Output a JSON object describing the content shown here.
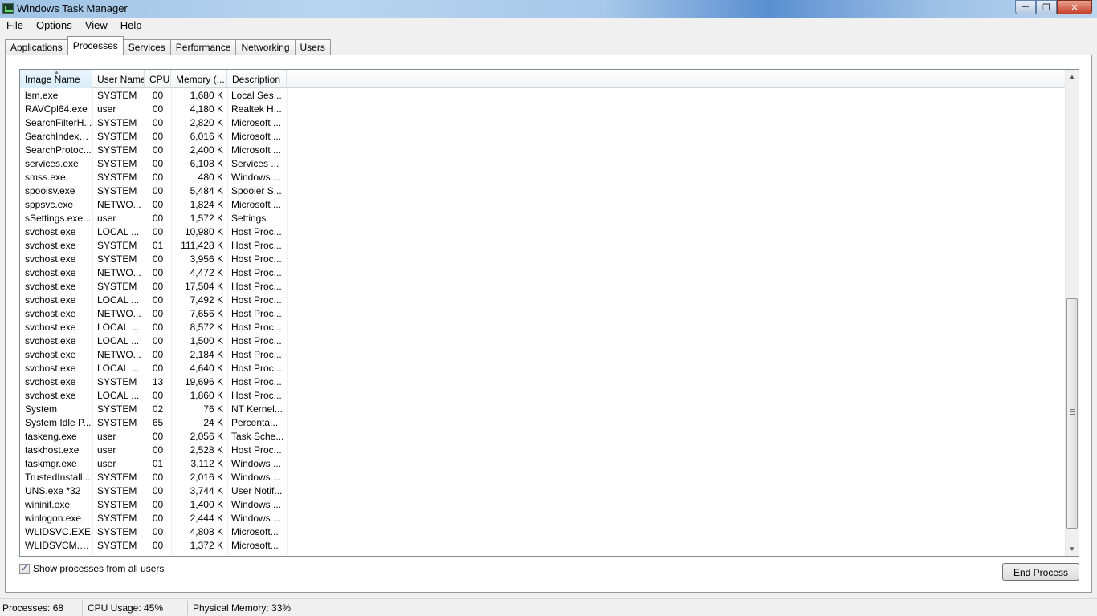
{
  "window": {
    "title": "Windows Task Manager"
  },
  "menu": [
    "File",
    "Options",
    "View",
    "Help"
  ],
  "tabs": [
    "Applications",
    "Processes",
    "Services",
    "Performance",
    "Networking",
    "Users"
  ],
  "active_tab": "Processes",
  "columns": [
    "Image Name",
    "User Name",
    "CPU",
    "Memory (...",
    "Description"
  ],
  "sort_column": "Image Name",
  "processes": [
    {
      "name": "lsm.exe",
      "user": "SYSTEM",
      "cpu": "00",
      "mem": "1,680 K",
      "desc": "Local Ses..."
    },
    {
      "name": "RAVCpl64.exe",
      "user": "user",
      "cpu": "00",
      "mem": "4,180 K",
      "desc": "Realtek H..."
    },
    {
      "name": "SearchFilterH...",
      "user": "SYSTEM",
      "cpu": "00",
      "mem": "2,820 K",
      "desc": "Microsoft ..."
    },
    {
      "name": "SearchIndexe...",
      "user": "SYSTEM",
      "cpu": "00",
      "mem": "6,016 K",
      "desc": "Microsoft ..."
    },
    {
      "name": "SearchProtoc...",
      "user": "SYSTEM",
      "cpu": "00",
      "mem": "2,400 K",
      "desc": "Microsoft ..."
    },
    {
      "name": "services.exe",
      "user": "SYSTEM",
      "cpu": "00",
      "mem": "6,108 K",
      "desc": "Services ..."
    },
    {
      "name": "smss.exe",
      "user": "SYSTEM",
      "cpu": "00",
      "mem": "480 K",
      "desc": "Windows ..."
    },
    {
      "name": "spoolsv.exe",
      "user": "SYSTEM",
      "cpu": "00",
      "mem": "5,484 K",
      "desc": "Spooler S..."
    },
    {
      "name": "sppsvc.exe",
      "user": "NETWO...",
      "cpu": "00",
      "mem": "1,824 K",
      "desc": "Microsoft ..."
    },
    {
      "name": "sSettings.exe...",
      "user": "user",
      "cpu": "00",
      "mem": "1,572 K",
      "desc": "Settings"
    },
    {
      "name": "svchost.exe",
      "user": "LOCAL ...",
      "cpu": "00",
      "mem": "10,980 K",
      "desc": "Host Proc..."
    },
    {
      "name": "svchost.exe",
      "user": "SYSTEM",
      "cpu": "01",
      "mem": "111,428 K",
      "desc": "Host Proc..."
    },
    {
      "name": "svchost.exe",
      "user": "SYSTEM",
      "cpu": "00",
      "mem": "3,956 K",
      "desc": "Host Proc..."
    },
    {
      "name": "svchost.exe",
      "user": "NETWO...",
      "cpu": "00",
      "mem": "4,472 K",
      "desc": "Host Proc..."
    },
    {
      "name": "svchost.exe",
      "user": "SYSTEM",
      "cpu": "00",
      "mem": "17,504 K",
      "desc": "Host Proc..."
    },
    {
      "name": "svchost.exe",
      "user": "LOCAL ...",
      "cpu": "00",
      "mem": "7,492 K",
      "desc": "Host Proc..."
    },
    {
      "name": "svchost.exe",
      "user": "NETWO...",
      "cpu": "00",
      "mem": "7,656 K",
      "desc": "Host Proc..."
    },
    {
      "name": "svchost.exe",
      "user": "LOCAL ...",
      "cpu": "00",
      "mem": "8,572 K",
      "desc": "Host Proc..."
    },
    {
      "name": "svchost.exe",
      "user": "LOCAL ...",
      "cpu": "00",
      "mem": "1,500 K",
      "desc": "Host Proc..."
    },
    {
      "name": "svchost.exe",
      "user": "NETWO...",
      "cpu": "00",
      "mem": "2,184 K",
      "desc": "Host Proc..."
    },
    {
      "name": "svchost.exe",
      "user": "LOCAL ...",
      "cpu": "00",
      "mem": "4,640 K",
      "desc": "Host Proc..."
    },
    {
      "name": "svchost.exe",
      "user": "SYSTEM",
      "cpu": "13",
      "mem": "19,696 K",
      "desc": "Host Proc..."
    },
    {
      "name": "svchost.exe",
      "user": "LOCAL ...",
      "cpu": "00",
      "mem": "1,860 K",
      "desc": "Host Proc..."
    },
    {
      "name": "System",
      "user": "SYSTEM",
      "cpu": "02",
      "mem": "76 K",
      "desc": "NT Kernel..."
    },
    {
      "name": "System Idle P...",
      "user": "SYSTEM",
      "cpu": "65",
      "mem": "24 K",
      "desc": "Percenta..."
    },
    {
      "name": "taskeng.exe",
      "user": "user",
      "cpu": "00",
      "mem": "2,056 K",
      "desc": "Task Sche..."
    },
    {
      "name": "taskhost.exe",
      "user": "user",
      "cpu": "00",
      "mem": "2,528 K",
      "desc": "Host Proc..."
    },
    {
      "name": "taskmgr.exe",
      "user": "user",
      "cpu": "01",
      "mem": "3,112 K",
      "desc": "Windows ..."
    },
    {
      "name": "TrustedInstall...",
      "user": "SYSTEM",
      "cpu": "00",
      "mem": "2,016 K",
      "desc": "Windows ..."
    },
    {
      "name": "UNS.exe *32",
      "user": "SYSTEM",
      "cpu": "00",
      "mem": "3,744 K",
      "desc": "User Notif..."
    },
    {
      "name": "wininit.exe",
      "user": "SYSTEM",
      "cpu": "00",
      "mem": "1,400 K",
      "desc": "Windows ..."
    },
    {
      "name": "winlogon.exe",
      "user": "SYSTEM",
      "cpu": "00",
      "mem": "2,444 K",
      "desc": "Windows ..."
    },
    {
      "name": "WLIDSVC.EXE",
      "user": "SYSTEM",
      "cpu": "00",
      "mem": "4,808 K",
      "desc": "Microsoft..."
    },
    {
      "name": "WLIDSVCM.EXE",
      "user": "SYSTEM",
      "cpu": "00",
      "mem": "1,372 K",
      "desc": "Microsoft..."
    }
  ],
  "show_all_label": "Show processes from all users",
  "show_all_checked": true,
  "end_process_label": "End Process",
  "status": {
    "processes": "Processes: 68",
    "cpu": "CPU Usage: 45%",
    "memory": "Physical Memory: 33%"
  }
}
